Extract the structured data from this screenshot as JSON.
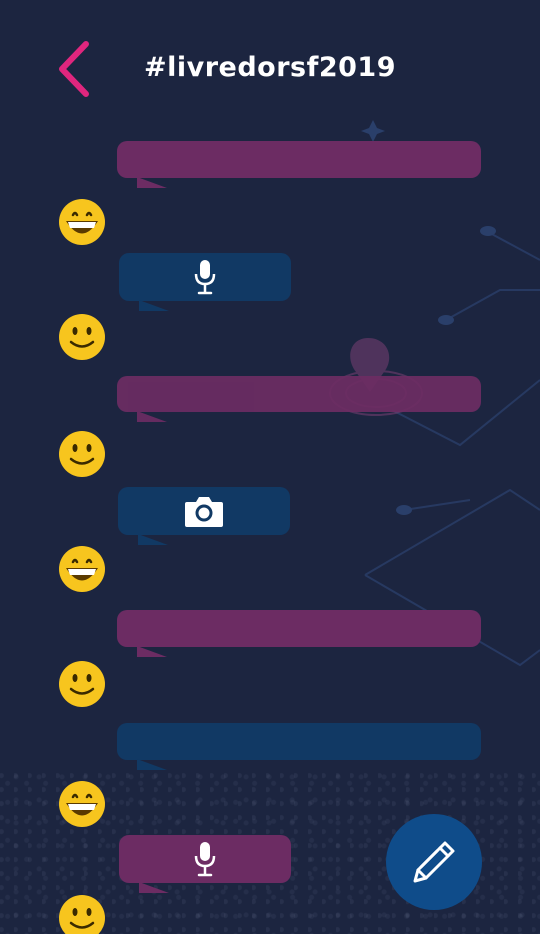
{
  "header": {
    "title": "#livredorsf2019",
    "back_icon": "chevron-left-icon"
  },
  "colors": {
    "background": "#1c2540",
    "accent": "#e0267e",
    "bubble_pink": "#6c2c63",
    "bubble_blue": "#113964",
    "fab": "#0f4c8a",
    "emoji": "#f7c51e"
  },
  "messages": [
    {
      "avatar": "grinning-emoji",
      "color": "pink",
      "content": "text"
    },
    {
      "avatar": "smiling-emoji",
      "color": "blue",
      "content": "microphone-icon"
    },
    {
      "avatar": "smiling-emoji",
      "color": "pink",
      "content": "text"
    },
    {
      "avatar": "grinning-emoji",
      "color": "blue",
      "content": "camera-icon"
    },
    {
      "avatar": "smiling-emoji",
      "color": "pink",
      "content": "text"
    },
    {
      "avatar": "grinning-emoji",
      "color": "blue",
      "content": "text"
    },
    {
      "avatar": "smiling-emoji",
      "color": "pink",
      "content": "microphone-icon"
    }
  ],
  "fab": {
    "icon": "pencil-icon"
  }
}
